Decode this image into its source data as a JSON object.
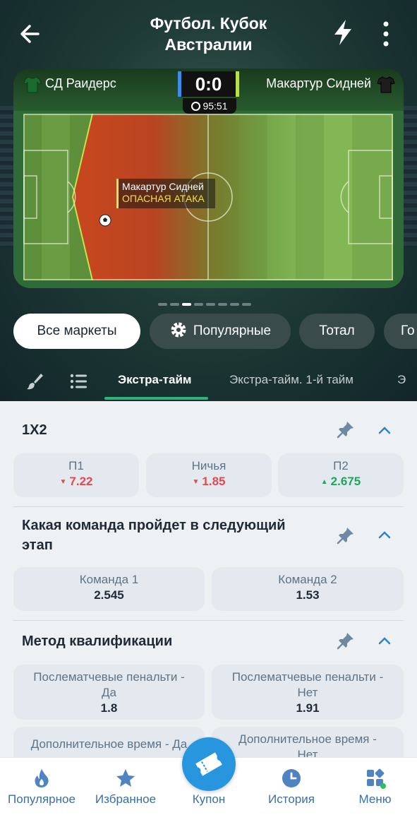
{
  "header": {
    "title_line1": "Футбол. Кубок",
    "title_line2": "Австралии"
  },
  "match": {
    "home_team": "СД Раидерс",
    "away_team": "Макартур Сидней",
    "score": "0:0",
    "time": "95:51",
    "event_team": "Макартур Сидней",
    "event_text": "ОПАСНАЯ АТАКА"
  },
  "filters": [
    "Все маркеты",
    "Популярные",
    "Тотал",
    "Го"
  ],
  "tabs": [
    "Экстра-тайм",
    "Экстра-тайм. 1-й тайм",
    "Э"
  ],
  "markets": {
    "m1": {
      "title": "1X2",
      "odds": [
        {
          "label": "П1",
          "value": "7.22",
          "trend": "down"
        },
        {
          "label": "Ничья",
          "value": "1.85",
          "trend": "down"
        },
        {
          "label": "П2",
          "value": "2.675",
          "trend": "up"
        }
      ]
    },
    "m2": {
      "title_line1": "Какая команда пройдет в следующий",
      "title_line2": "этап",
      "odds": [
        {
          "label": "Команда 1",
          "value": "2.545"
        },
        {
          "label": "Команда 2",
          "value": "1.53"
        }
      ]
    },
    "m3": {
      "title": "Метод квалификации",
      "odds": [
        {
          "label_line1": "Послематчевые пенальти -",
          "label_line2": "Да",
          "value": "1.8"
        },
        {
          "label_line1": "Послематчевые пенальти -",
          "label_line2": "Нет",
          "value": "1.91"
        },
        {
          "label_line1": "Дополнительное время - Да",
          "label_line2": ""
        },
        {
          "label_line1": "Дополнительное время -",
          "label_line2": "Нет"
        }
      ]
    }
  },
  "nav": {
    "popular": "Популярное",
    "favorites": "Избранное",
    "coupon": "Купон",
    "history": "История",
    "menu": "Меню"
  },
  "colors": {
    "accent": "#2896de",
    "up": "#1ea65a",
    "down": "#e5484d",
    "tab_underline": "#2fb17a"
  },
  "icons": [
    "back-arrow-icon",
    "lightning-icon",
    "more-vertical-icon",
    "jersey-icon",
    "clock-icon",
    "ball-icon",
    "gear-icon",
    "brush-icon",
    "list-icon",
    "pin-icon",
    "chevron-up-icon",
    "flame-icon",
    "star-icon",
    "ticket-icon",
    "history-clock-icon",
    "menu-grid-icon"
  ]
}
